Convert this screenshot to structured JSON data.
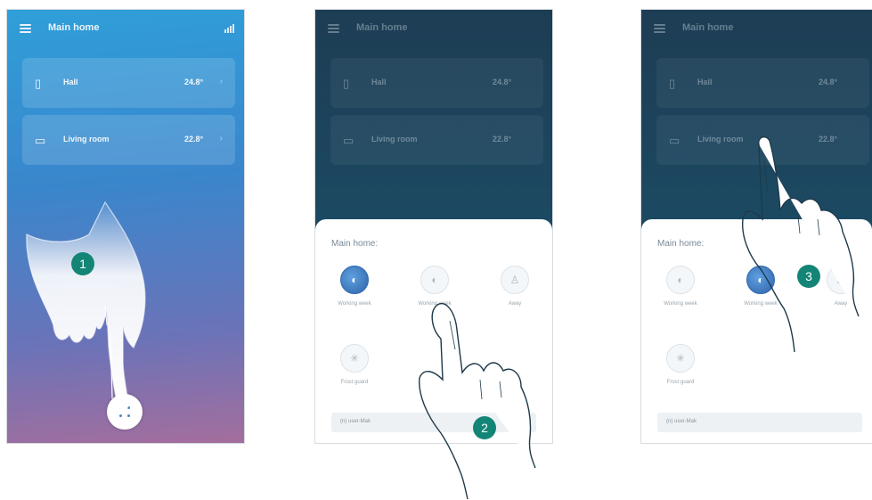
{
  "header": {
    "title": "Main home"
  },
  "rooms": [
    {
      "icon": "thermostat-icon",
      "name": "Hall",
      "temp": "24.8°"
    },
    {
      "icon": "sofa-icon",
      "name": "Living room",
      "temp": "22.8°"
    }
  ],
  "sheet": {
    "title": "Main home:",
    "scenarios": [
      {
        "label": "Working week",
        "icon": "drop-icon"
      },
      {
        "label": "Working week",
        "icon": "drop-icon"
      },
      {
        "label": "Away",
        "icon": "person-icon"
      },
      {
        "label": "Frost guard",
        "icon": "snowflake-icon"
      }
    ],
    "footer": "(n) user-Mak"
  },
  "steps": [
    "1",
    "2",
    "3"
  ]
}
